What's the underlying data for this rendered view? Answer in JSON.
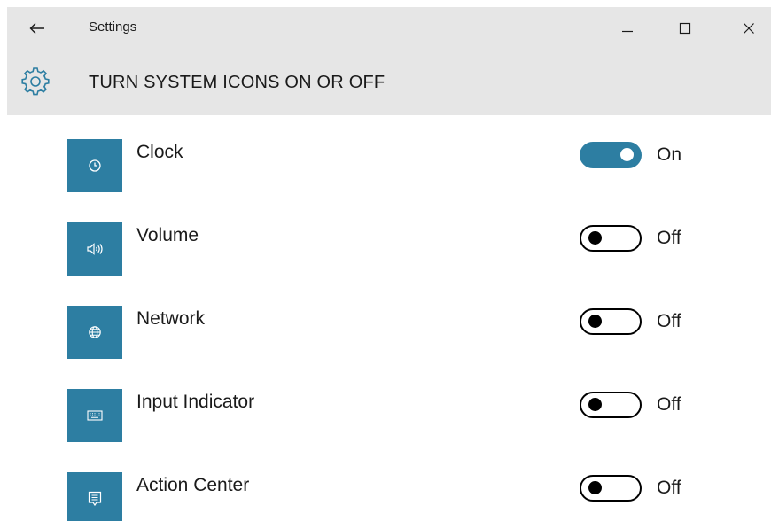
{
  "window": {
    "app_title": "Settings",
    "page_title": "TURN SYSTEM ICONS ON OR OFF"
  },
  "titlebar_icons": {
    "back": "back-arrow-icon",
    "minimize": "minimize-icon",
    "maximize": "maximize-icon",
    "close": "close-icon",
    "settings": "gear-icon"
  },
  "items": [
    {
      "label": "Clock",
      "icon": "clock-icon",
      "state": "on",
      "state_label": "On"
    },
    {
      "label": "Volume",
      "icon": "volume-icon",
      "state": "off",
      "state_label": "Off"
    },
    {
      "label": "Network",
      "icon": "network-globe-icon",
      "state": "off",
      "state_label": "Off"
    },
    {
      "label": "Input Indicator",
      "icon": "keyboard-icon",
      "state": "off",
      "state_label": "Off"
    },
    {
      "label": "Action Center",
      "icon": "action-center-icon",
      "state": "off",
      "state_label": "Off"
    }
  ],
  "colors": {
    "accent": "#2d7ea2",
    "header_bg": "#e6e6e6",
    "text": "#1a1a1a"
  }
}
